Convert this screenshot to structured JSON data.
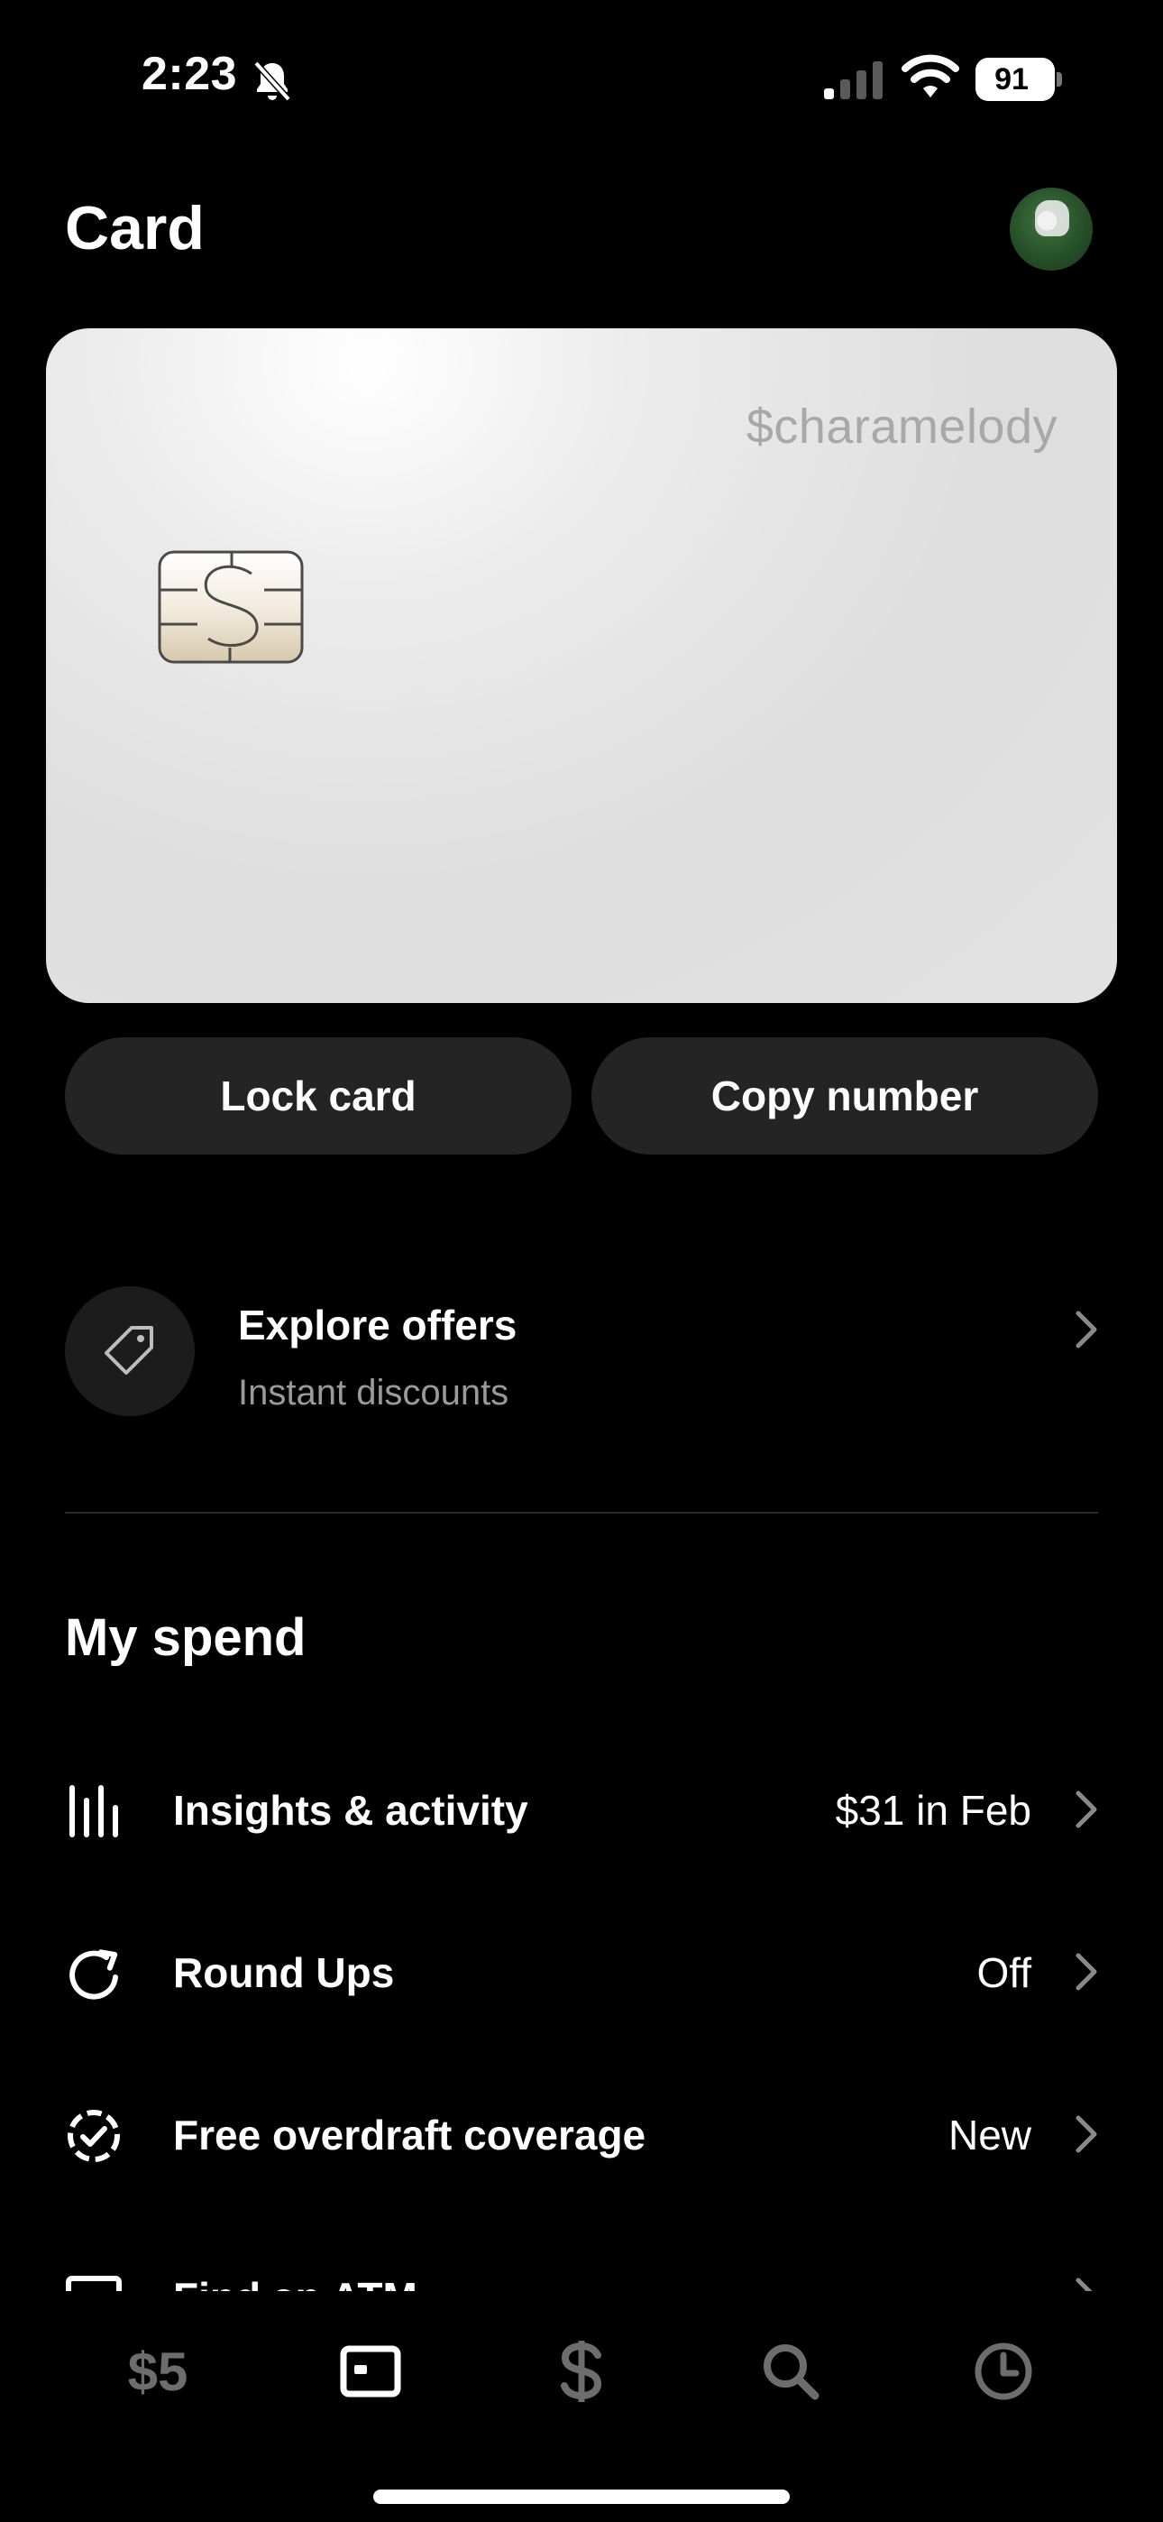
{
  "status_bar": {
    "time": "2:23",
    "battery": "91"
  },
  "header": {
    "title": "Card"
  },
  "card": {
    "cashtag": "$charamelody"
  },
  "actions": {
    "lock_label": "Lock card",
    "copy_label": "Copy number"
  },
  "offers": {
    "title": "Explore offers",
    "subtitle": "Instant discounts"
  },
  "spend": {
    "title": "My spend",
    "items": [
      {
        "label": "Insights & activity",
        "value": "$31 in Feb",
        "icon": "bar-chart-icon"
      },
      {
        "label": "Round Ups",
        "value": "Off",
        "icon": "round-up-arrow-icon"
      },
      {
        "label": "Free overdraft coverage",
        "value": "New",
        "icon": "dashed-check-circle-icon"
      },
      {
        "label": "Find an ATM",
        "value": "",
        "icon": "atm-icon"
      }
    ]
  },
  "tab_bar": {
    "money_label": "$5",
    "tabs": [
      "money-tab",
      "card-tab",
      "pay-tab",
      "search-tab",
      "activity-tab"
    ],
    "active": "card-tab"
  },
  "colors": {
    "background": "#000000",
    "button": "#242424",
    "card": "#e2e2e2",
    "muted_text": "#9a9a9a"
  }
}
